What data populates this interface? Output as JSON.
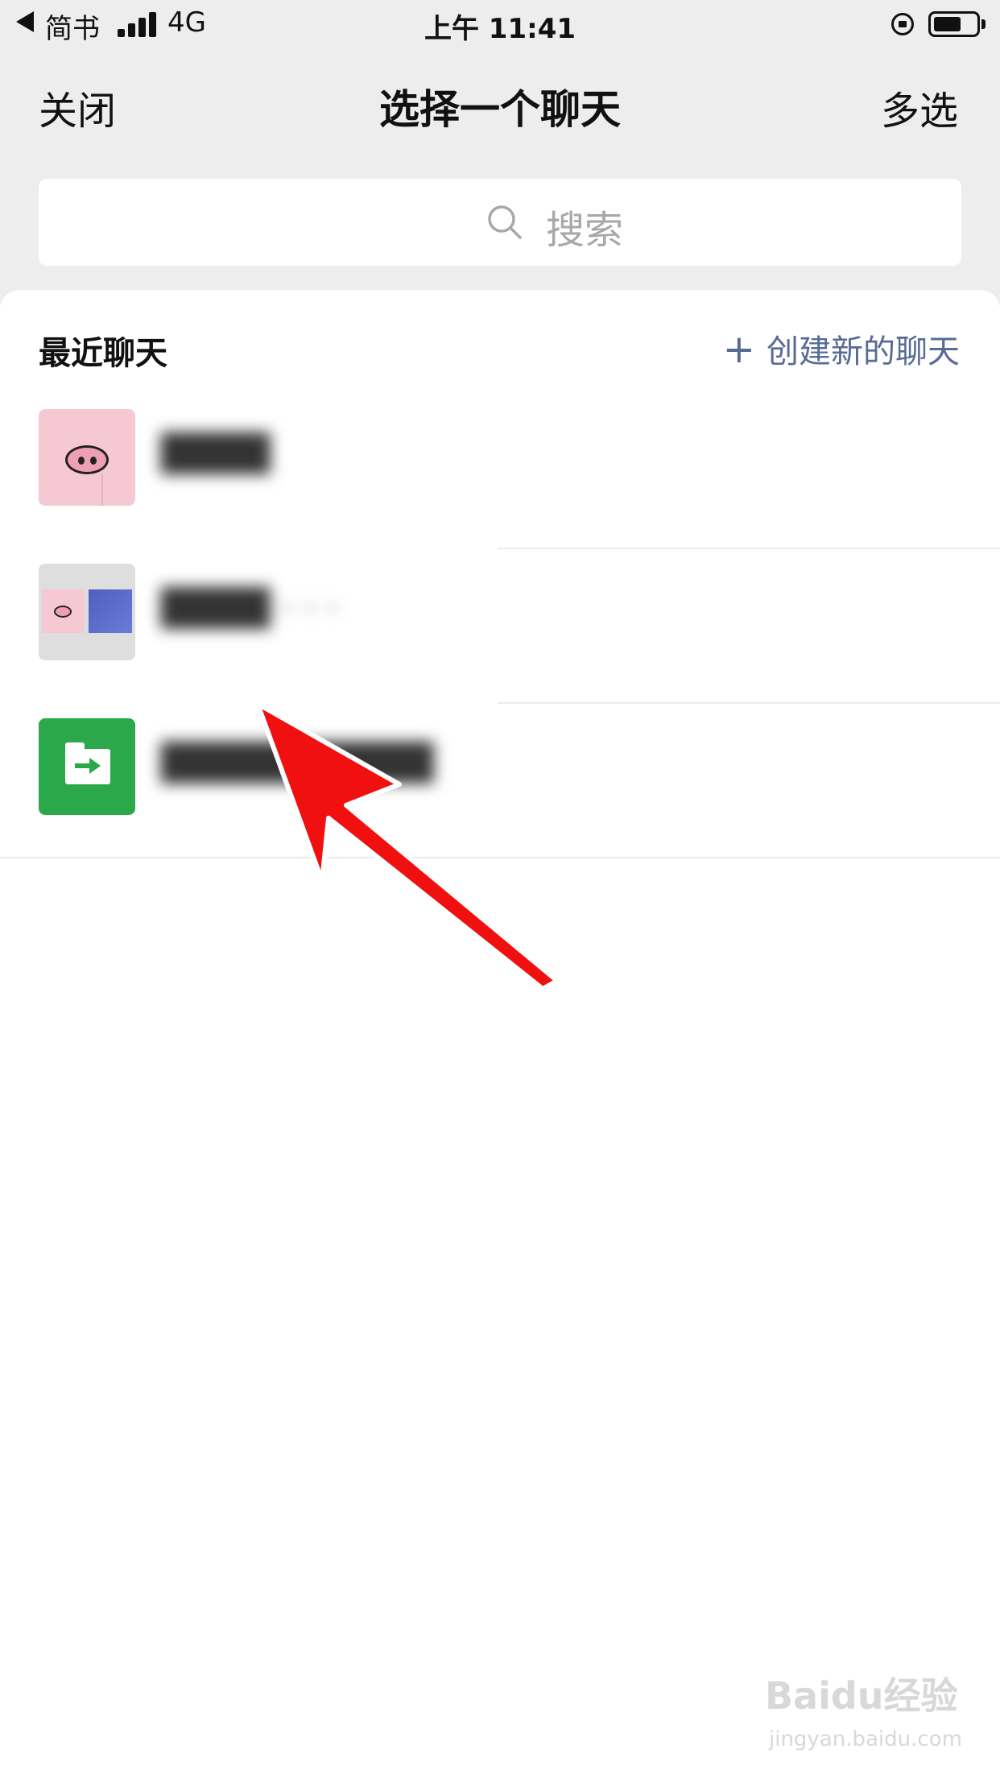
{
  "status_bar": {
    "back_app": "简书",
    "network": "4G",
    "time": "上午 11:41",
    "battery_level": 0.65
  },
  "nav": {
    "close_label": "关闭",
    "title": "选择一个聊天",
    "multi_select_label": "多选"
  },
  "search": {
    "placeholder": "搜索"
  },
  "recent": {
    "section_title": "最近聊天",
    "create_label": "创建新的聊天",
    "chats": [
      {
        "name": "████",
        "avatar": "pig-avatar"
      },
      {
        "name": "████ · · ·",
        "avatar": "group-avatar"
      },
      {
        "name": "██████████",
        "avatar": "file-transfer-avatar"
      }
    ]
  },
  "watermark": {
    "text": "Baidu经验",
    "url": "jingyan.baidu.com"
  },
  "colors": {
    "link": "#576b95",
    "header_bg": "#ededed",
    "file_green": "#2aa84a",
    "annotation_red": "#f01010"
  }
}
